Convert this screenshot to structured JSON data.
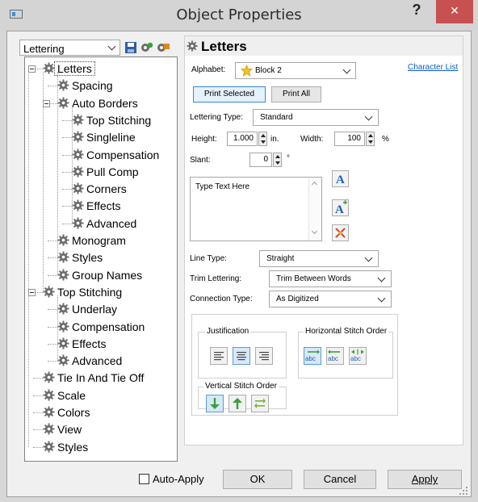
{
  "window": {
    "title": "Object Properties",
    "help": "?",
    "close": "✕"
  },
  "category": {
    "value": "Lettering",
    "icons": [
      "save-icon",
      "gear-icon",
      "export-icon"
    ]
  },
  "tree": [
    {
      "label": "Letters",
      "selected": true
    },
    {
      "label": "Spacing"
    },
    {
      "label": "Auto Borders"
    },
    {
      "label": "Top Stitching"
    },
    {
      "label": "Singleline"
    },
    {
      "label": "Compensation"
    },
    {
      "label": "Pull Comp"
    },
    {
      "label": "Corners"
    },
    {
      "label": "Effects"
    },
    {
      "label": "Advanced"
    },
    {
      "label": "Monogram"
    },
    {
      "label": "Styles"
    },
    {
      "label": "Group Names"
    },
    {
      "label": "Top Stitching"
    },
    {
      "label": "Underlay"
    },
    {
      "label": "Compensation"
    },
    {
      "label": "Effects"
    },
    {
      "label": "Advanced"
    },
    {
      "label": "Tie In And Tie Off"
    },
    {
      "label": "Scale"
    },
    {
      "label": "Colors"
    },
    {
      "label": "View"
    },
    {
      "label": "Styles"
    }
  ],
  "panel": {
    "title": "Letters",
    "alphabet_label": "Alphabet:",
    "alphabet_value": "Block 2",
    "character_list": "Character List",
    "print_selected": "Print Selected",
    "print_all": "Print All",
    "lettering_type_label": "Lettering Type:",
    "lettering_type_value": "Standard",
    "height_label": "Height:",
    "height_value": "1.000",
    "height_unit": "in.",
    "width_label": "Width:",
    "width_value": "100",
    "width_unit": "%",
    "slant_label": "Slant:",
    "slant_value": "0",
    "slant_unit": "°",
    "text_value": "Type Text Here",
    "line_type_label": "Line Type:",
    "line_type_value": "Straight",
    "trim_label": "Trim Lettering:",
    "trim_value": "Trim Between Words",
    "connection_label": "Connection Type:",
    "connection_value": "As Digitized",
    "justification_label": "Justification",
    "horizontal_label": "Horizontal Stitch Order",
    "vertical_label": "Vertical Stitch Order",
    "abc": "abc"
  },
  "footer": {
    "auto_apply": "Auto-Apply",
    "ok": "OK",
    "cancel": "Cancel",
    "apply": "Apply"
  },
  "colors": {
    "accent": "#3b86d6",
    "close": "#c75050",
    "gear": "#6b6b6b",
    "arrow_green": "#3aa03a"
  }
}
